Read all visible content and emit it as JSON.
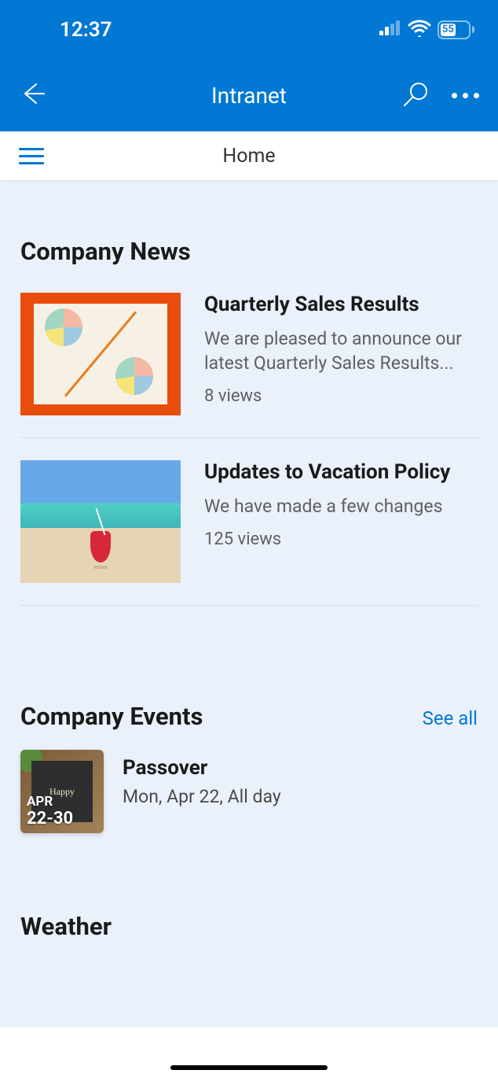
{
  "status_bar": {
    "time": "12:37",
    "battery_text": "55"
  },
  "header": {
    "title": "Intranet"
  },
  "sub_header": {
    "title": "Home"
  },
  "sections": {
    "news": {
      "title": "Company News",
      "items": [
        {
          "title": "Quarterly Sales Results",
          "excerpt": "We are pleased to announce our latest Quarterly Sales Results...",
          "views": "8 views"
        },
        {
          "title": "Updates to Vacation Policy",
          "excerpt": "We have made a few changes",
          "views": "125 views"
        }
      ]
    },
    "events": {
      "title": "Company Events",
      "see_all": "See all",
      "items": [
        {
          "badge_month": "APR",
          "badge_days": "22-30",
          "title": "Passover",
          "meta": "Mon, Apr 22, All day"
        }
      ]
    },
    "weather": {
      "title": "Weather"
    }
  }
}
